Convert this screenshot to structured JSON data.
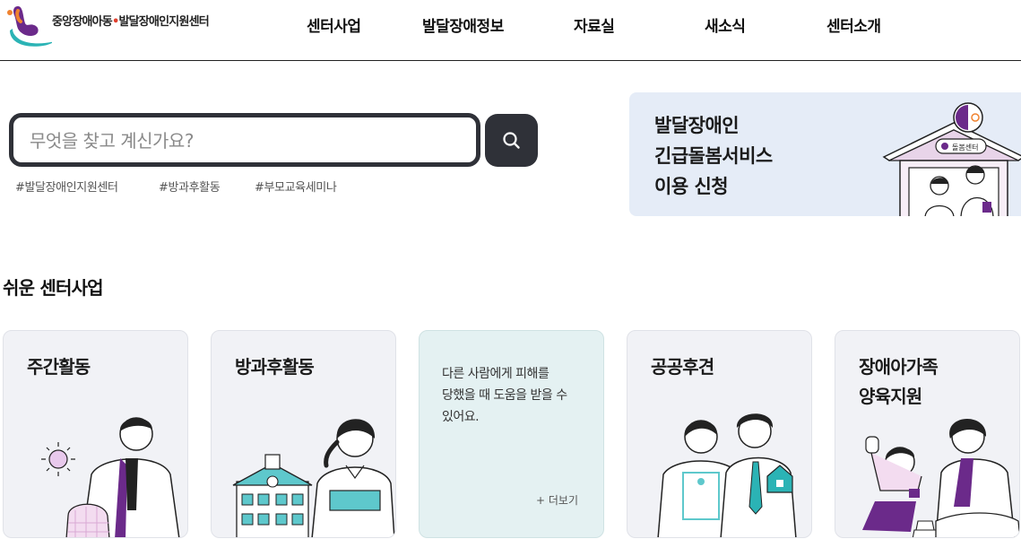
{
  "header": {
    "logo_text_1": "중앙장애아동",
    "logo_dot": "•",
    "logo_text_2": "발달장애인지원센터",
    "nav": [
      {
        "label": "센터사업"
      },
      {
        "label": "발달장애정보"
      },
      {
        "label": "자료실"
      },
      {
        "label": "새소식"
      },
      {
        "label": "센터소개"
      }
    ]
  },
  "search": {
    "placeholder": "무엇을 찾고 계신가요?",
    "value": "",
    "icon": "search-icon",
    "tags": [
      "#발달장애인지원센터",
      "#방과후활동",
      "#부모교육세미나"
    ]
  },
  "banner": {
    "lines": [
      "발달장애인",
      "긴급돌봄서비스",
      "이용 신청"
    ],
    "sign_text": "돌봄센터"
  },
  "section": {
    "title": "쉬운 센터사업"
  },
  "cards": [
    {
      "title_lines": [
        "주간활동"
      ]
    },
    {
      "title_lines": [
        "방과후활동"
      ]
    },
    {
      "desc_lines": [
        "다른 사람에게 피해를",
        "당했을 때 도움을 받을 수",
        "있어요."
      ],
      "more": "+ 더보기"
    },
    {
      "title_lines": [
        "공공후견"
      ]
    },
    {
      "title_lines": [
        "장애아가족",
        "양육지원"
      ]
    }
  ],
  "colors": {
    "dark": "#2f3138",
    "banner_bg": "#e5ecf7",
    "card_bg": "#f1f2f6",
    "card_highlight_bg": "#e4f1f2",
    "accent_purple": "#6b2a8a",
    "accent_teal": "#2bb3b5",
    "accent_orange": "#f0822e"
  }
}
